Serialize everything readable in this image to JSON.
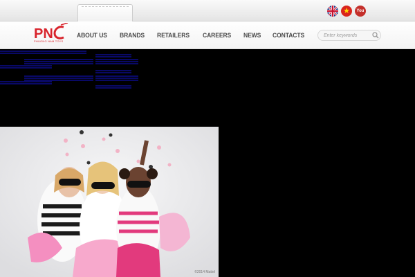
{
  "brand": {
    "name": "PNC",
    "tagline": "PHUONG NAM TOYS"
  },
  "languages": [
    {
      "icon": "uk-flag-icon",
      "label": "English"
    },
    {
      "icon": "vietnam-flag-icon",
      "label": "Vietnamese"
    },
    {
      "icon": "youtube-icon",
      "label": "YouTube"
    }
  ],
  "youtube_label": "You",
  "nav": {
    "items": [
      "ABOUT US",
      "BRANDS",
      "RETAILERS",
      "CAREERS",
      "NEWS",
      "CONTACTS"
    ]
  },
  "search": {
    "placeholder": "Enter keywords"
  },
  "hero": {
    "copyright": "©2014 Mattel"
  },
  "colors": {
    "brand_red": "#d8242c",
    "link_blue": "#1414d6",
    "nav_text": "#4a4a4a",
    "page_bg": "#000000"
  }
}
